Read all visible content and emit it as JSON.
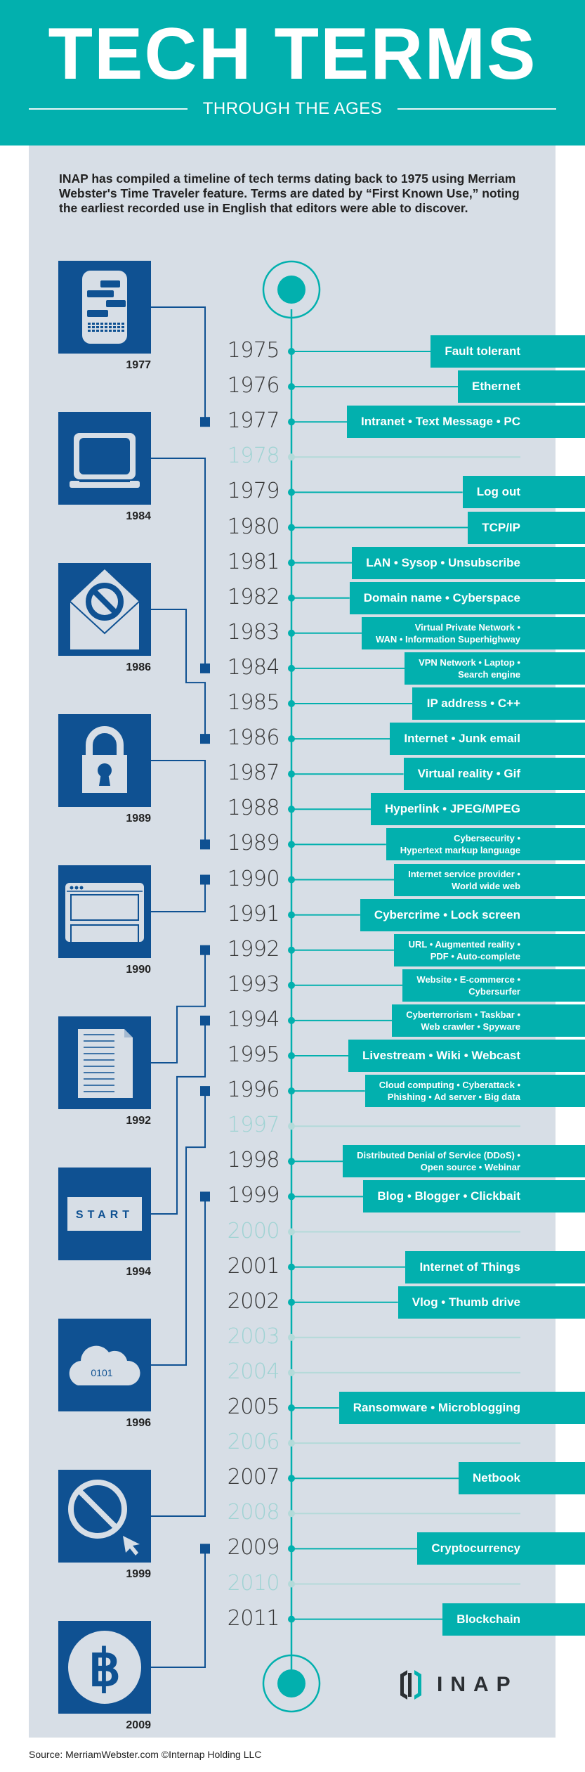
{
  "header": {
    "title": "TECH TERMS",
    "subtitle": "THROUGH THE AGES"
  },
  "intro": "INAP has compiled a timeline of tech terms dating back to 1975 using Merriam Webster's Time Traveler feature. Terms are dated by “First Known Use,” noting the earliest recorded use in English that editors were able to discover.",
  "colors": {
    "teal": "#02b0ae",
    "navy": "#0f5192",
    "panel": "#d7dee6",
    "empty_year": "#9fd3d3"
  },
  "timeline": [
    {
      "year": "1975",
      "terms": "Fault tolerant",
      "empty": false
    },
    {
      "year": "1976",
      "terms": "Ethernet",
      "empty": false
    },
    {
      "year": "1977",
      "terms": "Intranet • Text Message • PC",
      "empty": false
    },
    {
      "year": "1978",
      "terms": "",
      "empty": true
    },
    {
      "year": "1979",
      "terms": "Log out",
      "empty": false
    },
    {
      "year": "1980",
      "terms": "TCP/IP",
      "empty": false
    },
    {
      "year": "1981",
      "terms": "LAN • Sysop • Unsubscribe",
      "empty": false
    },
    {
      "year": "1982",
      "terms": "Domain name • Cyberspace",
      "empty": false
    },
    {
      "year": "1983",
      "terms": "Virtual Private Network •\nWAN • Information Superhighway",
      "empty": false,
      "small": true
    },
    {
      "year": "1984",
      "terms": "VPN Network • Laptop •\nSearch engine",
      "empty": false,
      "small": true
    },
    {
      "year": "1985",
      "terms": "IP address • C++",
      "empty": false
    },
    {
      "year": "1986",
      "terms": "Internet • Junk email",
      "empty": false
    },
    {
      "year": "1987",
      "terms": "Virtual reality • Gif",
      "empty": false
    },
    {
      "year": "1988",
      "terms": "Hyperlink • JPEG/MPEG",
      "empty": false
    },
    {
      "year": "1989",
      "terms": "Cybersecurity •\nHypertext markup language",
      "empty": false,
      "small": true
    },
    {
      "year": "1990",
      "terms": "Internet service provider •\nWorld wide web",
      "empty": false,
      "small": true
    },
    {
      "year": "1991",
      "terms": "Cybercrime • Lock screen",
      "empty": false
    },
    {
      "year": "1992",
      "terms": "URL • Augmented reality •\nPDF • Auto-complete",
      "empty": false,
      "small": true
    },
    {
      "year": "1993",
      "terms": "Website • E-commerce •\nCybersurfer",
      "empty": false,
      "small": true
    },
    {
      "year": "1994",
      "terms": "Cyberterrorism • Taskbar •\nWeb crawler • Spyware",
      "empty": false,
      "small": true
    },
    {
      "year": "1995",
      "terms": "Livestream • Wiki • Webcast",
      "empty": false
    },
    {
      "year": "1996",
      "terms": "Cloud computing • Cyberattack •\nPhishing • Ad server • Big data",
      "empty": false,
      "small": true
    },
    {
      "year": "1997",
      "terms": "",
      "empty": true
    },
    {
      "year": "1998",
      "terms": "Distributed Denial of Service (DDoS) •\nOpen source • Webinar",
      "empty": false,
      "small": true
    },
    {
      "year": "1999",
      "terms": "Blog • Blogger • Clickbait",
      "empty": false
    },
    {
      "year": "2000",
      "terms": "",
      "empty": true
    },
    {
      "year": "2001",
      "terms": "Internet of Things",
      "empty": false
    },
    {
      "year": "2002",
      "terms": "Vlog • Thumb drive",
      "empty": false
    },
    {
      "year": "2003",
      "terms": "",
      "empty": true
    },
    {
      "year": "2004",
      "terms": "",
      "empty": true
    },
    {
      "year": "2005",
      "terms": "Ransomware • Microblogging",
      "empty": false
    },
    {
      "year": "2006",
      "terms": "",
      "empty": true
    },
    {
      "year": "2007",
      "terms": "Netbook",
      "empty": false
    },
    {
      "year": "2008",
      "terms": "",
      "empty": true
    },
    {
      "year": "2009",
      "terms": "Cryptocurrency",
      "empty": false
    },
    {
      "year": "2010",
      "terms": "",
      "empty": true
    },
    {
      "year": "2011",
      "terms": "Blockchain",
      "empty": false
    }
  ],
  "icons": [
    {
      "year": "1977",
      "icon": "text-message-phone-icon",
      "connects_to": "1977"
    },
    {
      "year": "1984",
      "icon": "laptop-icon",
      "connects_to": "1984"
    },
    {
      "year": "1986",
      "icon": "junk-email-icon",
      "connects_to": "1986"
    },
    {
      "year": "1989",
      "icon": "padlock-icon",
      "connects_to": "1989"
    },
    {
      "year": "1990",
      "icon": "browser-window-icon",
      "connects_to": "1990"
    },
    {
      "year": "1992",
      "icon": "document-icon",
      "connects_to": "1992"
    },
    {
      "year": "1994",
      "icon": "start-button-icon",
      "connects_to": "1994",
      "text": "START"
    },
    {
      "year": "1996",
      "icon": "cloud-data-icon",
      "connects_to": "1996",
      "text": "0101"
    },
    {
      "year": "1999",
      "icon": "blocked-cursor-icon",
      "connects_to": "1999"
    },
    {
      "year": "2009",
      "icon": "bitcoin-icon",
      "connects_to": "2009"
    }
  ],
  "logo": {
    "text": "INAP"
  },
  "source": "Source: MerriamWebster.com ©Internap Holding LLC"
}
